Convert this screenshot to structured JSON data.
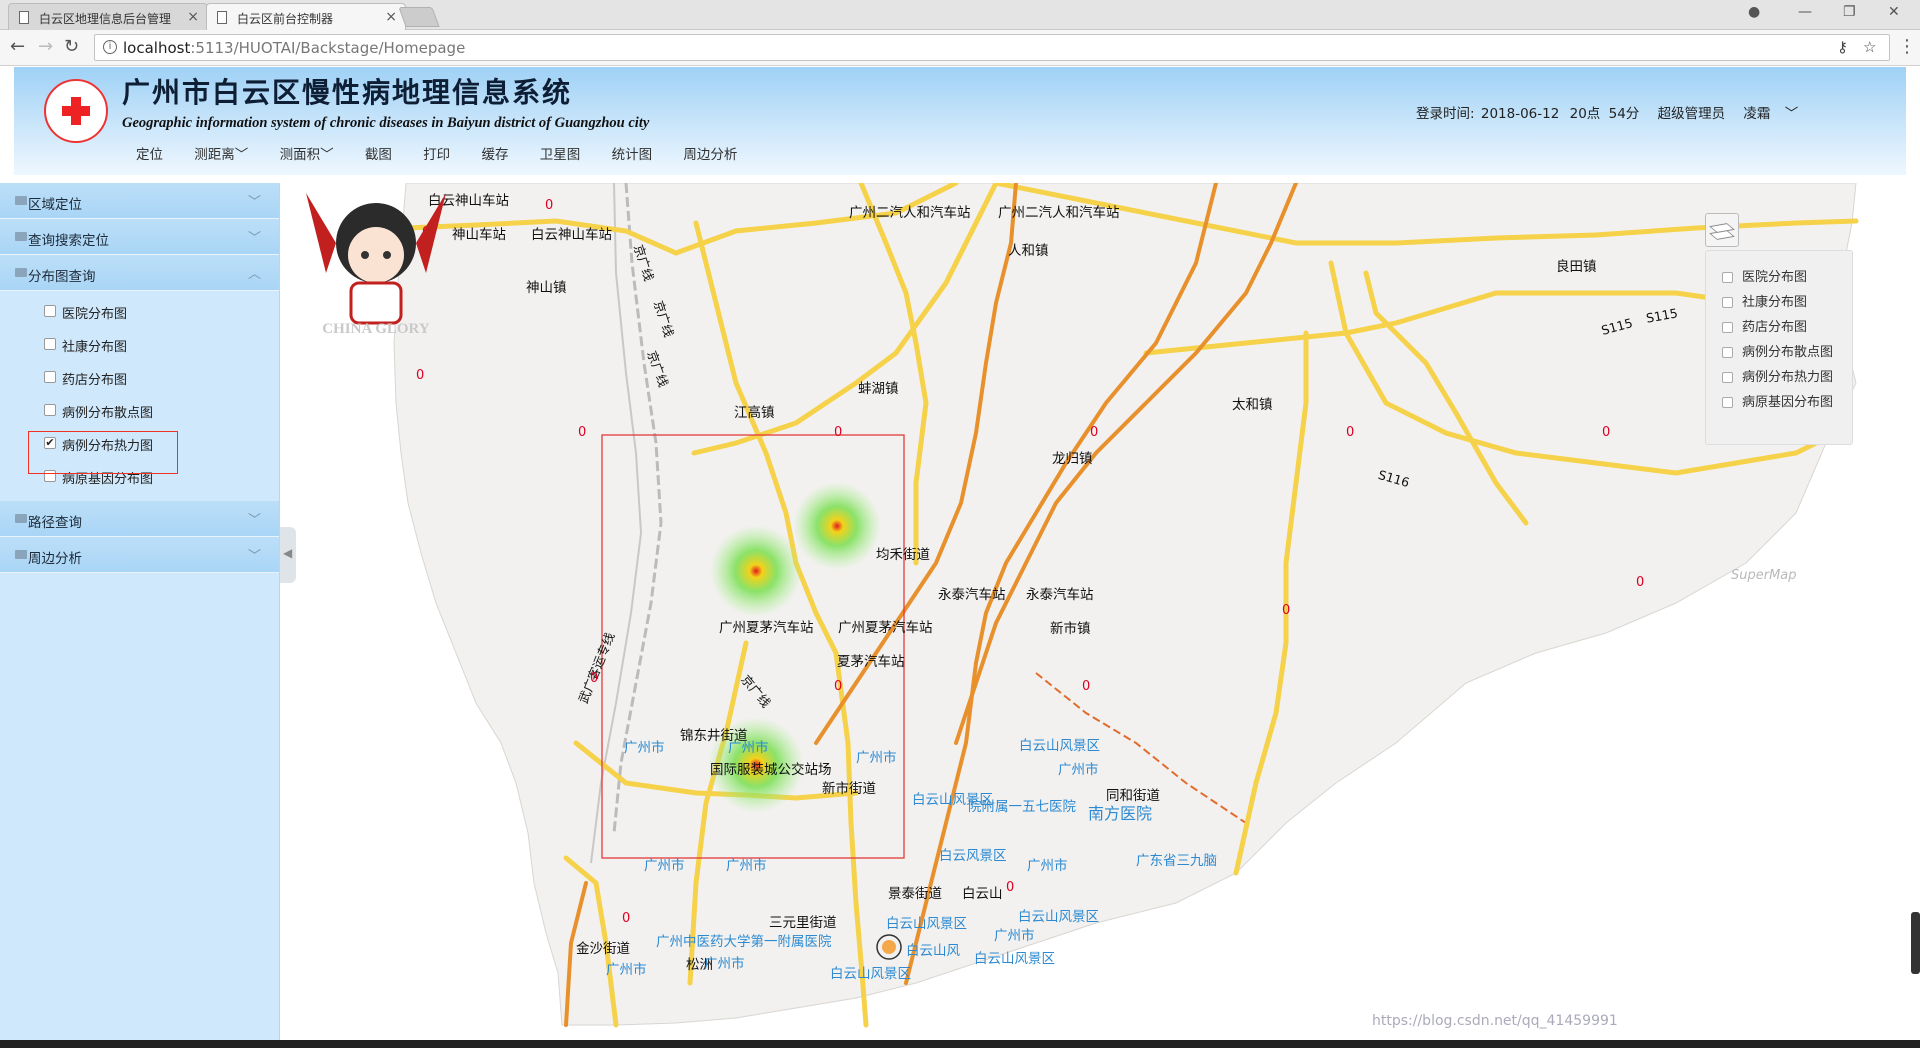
{
  "browser": {
    "tabs": [
      {
        "label": "白云区地理信息后台管理"
      },
      {
        "label": "白云区前台控制器"
      }
    ],
    "url_host": "localhost",
    "url_port_path": ":5113/HUOTAI/Backstage/Homepage"
  },
  "header": {
    "title_cn": "广州市白云区慢性病地理信息系统",
    "title_en": "Geographic information system of chronic diseases in Baiyun district of Guangzhou city",
    "login_label": "登录时间:",
    "login_date": "2018-06-12",
    "login_hour": "20点",
    "login_minute": "54分",
    "role": "超级管理员",
    "username": "凌霜"
  },
  "menu": [
    {
      "label": "定位",
      "dropdown": false
    },
    {
      "label": "测距离",
      "dropdown": true
    },
    {
      "label": "测面积",
      "dropdown": true
    },
    {
      "label": "截图",
      "dropdown": false
    },
    {
      "label": "打印",
      "dropdown": false
    },
    {
      "label": "缓存",
      "dropdown": false
    },
    {
      "label": "卫星图",
      "dropdown": false
    },
    {
      "label": "统计图",
      "dropdown": false
    },
    {
      "label": "周边分析",
      "dropdown": false
    }
  ],
  "sidebar": {
    "sections": {
      "region": "区域定位",
      "search": "查询搜索定位",
      "distribution": "分布图查询",
      "route": "路径查询",
      "nearby": "周边分析"
    },
    "distribution_items": [
      {
        "label": "医院分布图",
        "checked": false
      },
      {
        "label": "社康分布图",
        "checked": false
      },
      {
        "label": "药店分布图",
        "checked": false
      },
      {
        "label": "病例分布散点图",
        "checked": false
      },
      {
        "label": "病例分布热力图",
        "checked": true
      },
      {
        "label": "病原基因分布图",
        "checked": false
      }
    ]
  },
  "layer_panel": {
    "items": [
      {
        "label": "医院分布图",
        "checked": false
      },
      {
        "label": "社康分布图",
        "checked": false
      },
      {
        "label": "药店分布图",
        "checked": false
      },
      {
        "label": "病例分布散点图",
        "checked": false
      },
      {
        "label": "病例分布热力图",
        "checked": false
      },
      {
        "label": "病原基因分布图",
        "checked": false
      }
    ]
  },
  "map": {
    "labels": [
      {
        "t": "白云神山车站"
      },
      {
        "t": "神山车站"
      },
      {
        "t": "白云神山车站"
      },
      {
        "t": "广州二汽人和汽车站"
      },
      {
        "t": "广州二汽人和汽车站"
      },
      {
        "t": "人和镇"
      },
      {
        "t": "神山镇"
      },
      {
        "t": "蚌湖镇"
      },
      {
        "t": "江高镇"
      },
      {
        "t": "龙归镇"
      },
      {
        "t": "太和镇"
      },
      {
        "t": "良田镇"
      },
      {
        "t": "均禾街道"
      },
      {
        "t": "永泰汽车站"
      },
      {
        "t": "永泰汽车站"
      },
      {
        "t": "新市镇"
      },
      {
        "t": "广州夏茅汽车站"
      },
      {
        "t": "广州夏茅汽车站"
      },
      {
        "t": "夏茅汽车站"
      },
      {
        "t": "锦东井街道"
      },
      {
        "t": "国际服装城公交站场"
      },
      {
        "t": "新市街道"
      },
      {
        "t": "同和街道"
      },
      {
        "t": "景泰街道"
      },
      {
        "t": "白云山"
      },
      {
        "t": "三元里街道"
      },
      {
        "t": "金沙街道"
      },
      {
        "t": "松洲"
      },
      {
        "t": "京广线"
      },
      {
        "t": "京广线"
      },
      {
        "t": "京广线"
      },
      {
        "t": "武广客运专线"
      },
      {
        "t": "京广线"
      },
      {
        "t": "S115"
      },
      {
        "t": "S115"
      },
      {
        "t": "S116"
      }
    ],
    "blue_labels": [
      {
        "t": "广州市"
      },
      {
        "t": "广州市"
      },
      {
        "t": "广州市"
      },
      {
        "t": "白云山风景区"
      },
      {
        "t": "广州市"
      },
      {
        "t": "白云山风景区"
      },
      {
        "t": "院附属一五七医院"
      },
      {
        "t": "南方医院"
      },
      {
        "t": "白云风景区"
      },
      {
        "t": "广州市"
      },
      {
        "t": "广州市"
      },
      {
        "t": "广州市"
      },
      {
        "t": "广东省三九脑"
      },
      {
        "t": "白云山风景区"
      },
      {
        "t": "白云山风景区"
      },
      {
        "t": "广州市"
      },
      {
        "t": "广州中医药大学第一附属医院"
      },
      {
        "t": "白云山风"
      },
      {
        "t": "白云山风景区"
      },
      {
        "t": "广州市"
      },
      {
        "t": "广州市"
      },
      {
        "t": "白云山风景区"
      }
    ],
    "zero_label": "0",
    "supermap_mark": "SuperMap"
  },
  "watermark": {
    "blog": "https://blog.csdn.net/qq_41459991",
    "mascot_text": "CHINA GLORY"
  },
  "colors": {
    "header_top": "#9fd1f6",
    "sidebar_bg": "#cfe8fb",
    "highlight_border": "#e32222",
    "road_yellow": "#f5d24a",
    "road_orange": "#e8902c",
    "land": "#f3f2f0"
  }
}
